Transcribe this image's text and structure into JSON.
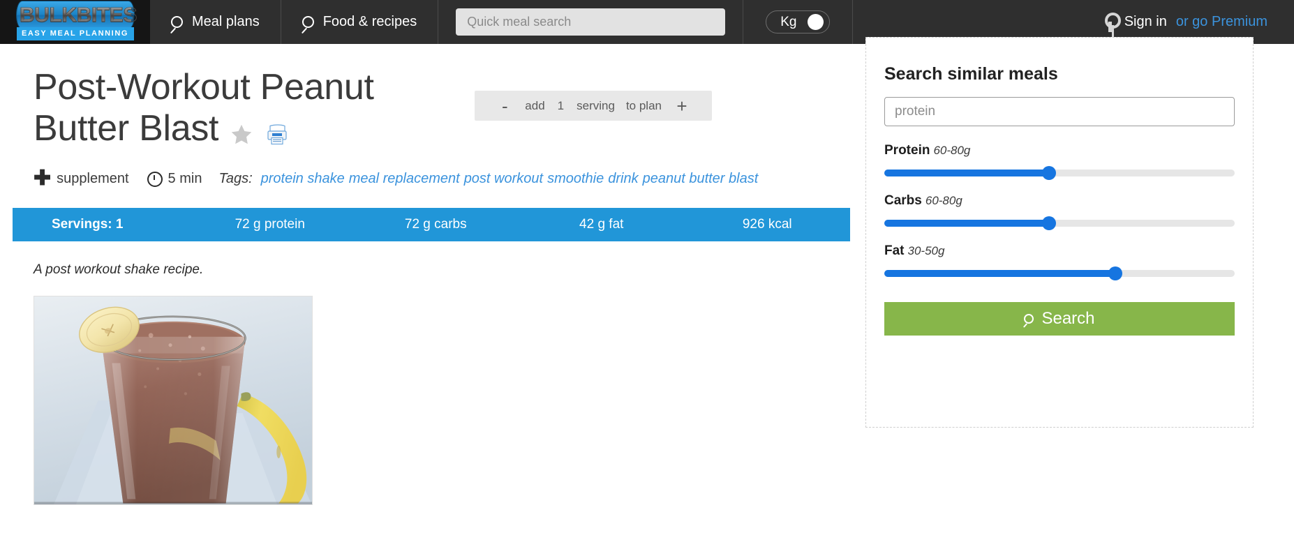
{
  "topbar": {
    "logo": {
      "word": "BULKBITES",
      "tagline": "EASY MEAL PLANNING"
    },
    "nav": [
      {
        "label": "Meal plans",
        "icon": "search-icon"
      },
      {
        "label": "Food & recipes",
        "icon": "search-icon"
      }
    ],
    "quick_search": {
      "placeholder": "Quick meal search",
      "value": ""
    },
    "unit_toggle": {
      "label": "Kg",
      "state": "on"
    },
    "account": {
      "icon": "key-icon",
      "sign_in": "Sign in",
      "premium": "or go Premium"
    }
  },
  "recipe": {
    "title": "Post-Workout Peanut Butter Blast",
    "favorite_icon": "star-icon",
    "print_icon": "print-icon",
    "serving_control": {
      "minus": "-",
      "add": "add",
      "count": "1",
      "serving": "serving",
      "to_plan": "to plan",
      "plus": "+"
    },
    "meta": {
      "category_icon": "plus-icon",
      "category": "supplement",
      "time_icon": "clock-icon",
      "time": "5 min",
      "tags_label": "Tags:",
      "tags": [
        "protein shake",
        "meal replacement",
        "post workout",
        "smoothie",
        "drink",
        "peanut butter blast"
      ]
    },
    "nutrition": {
      "bar_color": "#2196d8",
      "servings": "Servings: 1",
      "protein": "72 g protein",
      "carbs": "72 g carbs",
      "fat": "42 g fat",
      "kcal": "926 kcal"
    },
    "description": "A post workout shake recipe.",
    "photo_alt": "chocolate peanut butter banana smoothie in a tall glass"
  },
  "sidebar": {
    "title": "Search similar meals",
    "query_input": {
      "placeholder": "protein",
      "value": ""
    },
    "sliders": [
      {
        "name": "Protein",
        "range": "60-80g",
        "percent": 47,
        "accent": "#1675e0"
      },
      {
        "name": "Carbs",
        "range": "60-80g",
        "percent": 47,
        "accent": "#1675e0"
      },
      {
        "name": "Fat",
        "range": "30-50g",
        "percent": 66,
        "accent": "#1675e0"
      }
    ],
    "search_button": {
      "label": "Search",
      "icon": "search-icon",
      "color": "#87b64a"
    }
  }
}
